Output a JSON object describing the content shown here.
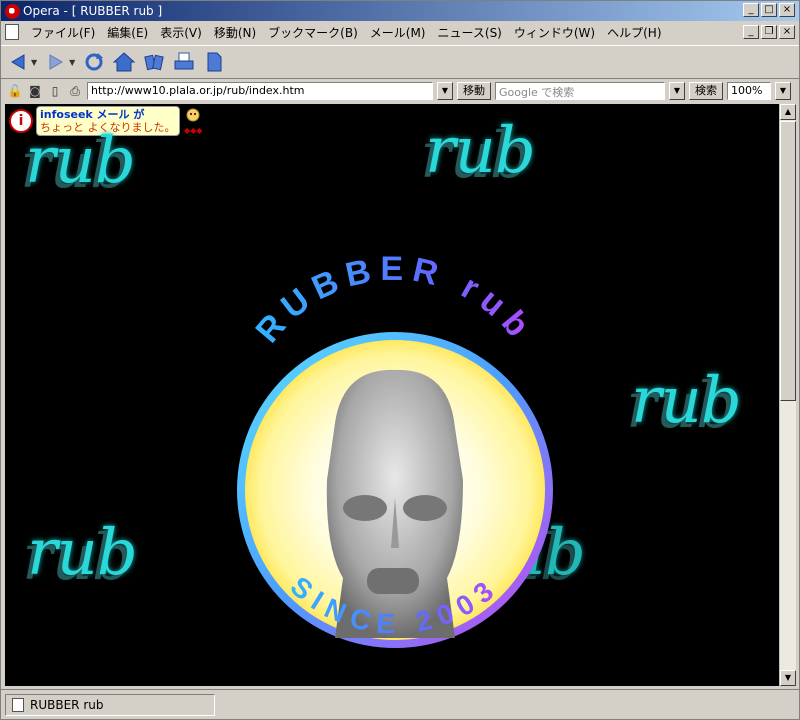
{
  "window": {
    "title": "Opera - [ RUBBER rub ]"
  },
  "menubar": {
    "items": [
      "ファイル(F)",
      "編集(E)",
      "表示(V)",
      "移動(N)",
      "ブックマーク(B)",
      "メール(M)",
      "ニュース(S)",
      "ウィンドウ(W)",
      "ヘルプ(H)"
    ]
  },
  "addressbar": {
    "url": "http://www10.plala.or.jp/rub/index.htm",
    "go_label": "移動",
    "search_placeholder": "Google で検索",
    "search_label": "検索",
    "zoom": "100%"
  },
  "page": {
    "banner": {
      "line1": "infoseek メール が",
      "line2": "ちょっと よくなりました。"
    },
    "rub_text": "rub",
    "emblem": {
      "top_text": "RUBBER rub",
      "bottom_text": "SINCE 2003"
    }
  },
  "statusbar": {
    "tab_title": "RUBBER rub"
  },
  "colors": {
    "accent": "#29d8d8",
    "titlebar": "#0a246a",
    "ring_inner": "#fffbb0",
    "ring_outer": "#7f5cff"
  }
}
